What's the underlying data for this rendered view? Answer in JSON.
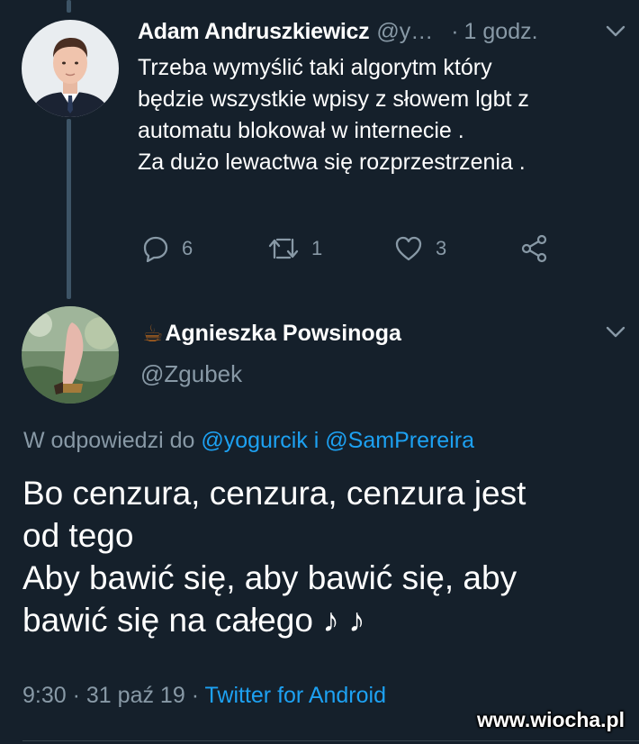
{
  "tweet1": {
    "name": "Adam Andruszkiewicz",
    "handle": "@y…",
    "separator": "·",
    "time": "1 godz.",
    "lines": [
      "Trzeba wymyślić taki algorytm który",
      "będzie wszystkie wpisy z słowem lgbt z",
      "automatu blokował w internecie .",
      "Za dużo lewactwa się rozprzestrzenia ."
    ],
    "actions": {
      "reply_count": "6",
      "retweet_count": "1",
      "like_count": "3"
    }
  },
  "tweet2": {
    "emoji": "☕",
    "name": "Agnieszka Powsinoga",
    "handle": "@Zgubek",
    "reply_prefix": "W odpowiedzi do",
    "reply_mention1": "@yogurcik",
    "reply_and": "i",
    "reply_mention2": "@SamPrereira",
    "lines": [
      "Bo cenzura, cenzura, cenzura jest",
      "od tego",
      "Aby bawić się, aby bawić się, aby",
      "bawić się na całego ♪ ♪"
    ],
    "time": "9:30",
    "separator": "·",
    "date": "31 paź 19",
    "source": "Twitter for Android"
  },
  "watermark": "www.wiocha.pl",
  "colors": {
    "background": "#15202b",
    "secondary_text": "#8899a6",
    "link": "#1da1f2",
    "thread_line": "#3d5466"
  },
  "icons": [
    "chevron-down-icon",
    "reply-icon",
    "retweet-icon",
    "like-icon",
    "share-icon",
    "coffee-emoji-icon"
  ]
}
